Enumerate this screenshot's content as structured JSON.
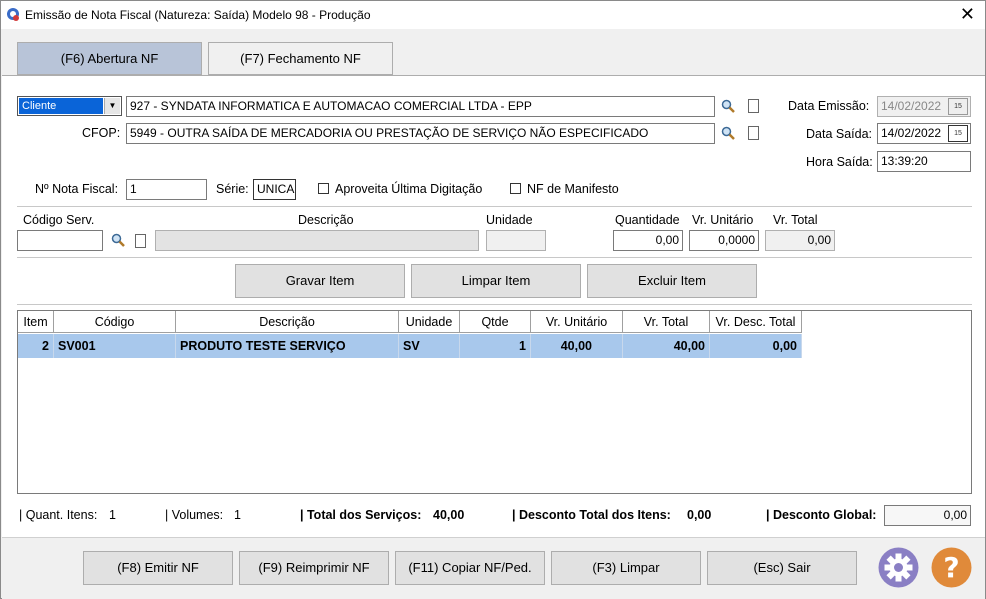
{
  "window": {
    "title": "Emissão de Nota Fiscal (Natureza: Saída) Modelo 98 - Produção",
    "close_glyph": "✕"
  },
  "tabs": [
    {
      "label": "(F6) Abertura NF"
    },
    {
      "label": "(F7) Fechamento NF"
    }
  ],
  "header": {
    "party_type": "Cliente",
    "party_value": "927 - SYNDATA INFORMATICA E AUTOMACAO COMERCIAL LTDA - EPP",
    "cfop_label": "CFOP:",
    "cfop_value": "5949 - OUTRA SAÍDA DE MERCADORIA OU PRESTAÇÃO DE SERVIÇO NÃO ESPECIFICADO",
    "data_emissao_label": "Data Emissão:",
    "data_emissao_value": "14/02/2022",
    "data_saida_label": "Data Saída:",
    "data_saida_value": "14/02/2022",
    "hora_saida_label": "Hora Saída:",
    "hora_saida_value": "13:39:20",
    "calendar_day": "15",
    "nf_label": "Nº Nota Fiscal:",
    "nf_value": "1",
    "serie_label": "Série:",
    "serie_value": "UNICA",
    "aproveita_label": "Aproveita Última Digitação",
    "manifesto_label": "NF de Manifesto"
  },
  "item_entry": {
    "codigo_label": "Código Serv.",
    "descricao_label": "Descrição",
    "unidade_label": "Unidade",
    "quantidade_label": "Quantidade",
    "vr_unitario_label": "Vr. Unitário",
    "vr_total_label": "Vr. Total",
    "quantidade_value": "0,00",
    "vr_unitario_value": "0,0000",
    "vr_total_value": "0,00"
  },
  "item_buttons": {
    "gravar": "Gravar Item",
    "limpar": "Limpar Item",
    "excluir": "Excluir Item"
  },
  "table": {
    "columns": [
      "Item",
      "Código",
      "Descrição",
      "Unidade",
      "Qtde",
      "Vr. Unitário",
      "Vr. Total",
      "Vr. Desc. Total"
    ],
    "rows": [
      [
        "2",
        "SV001",
        "PRODUTO TESTE SERVIÇO",
        "SV",
        "1",
        "40,00",
        "40,00",
        "0,00"
      ]
    ]
  },
  "status": {
    "quant_itens_label": "| Quant. Itens:",
    "quant_itens_value": "1",
    "volumes_label": "| Volumes:",
    "volumes_value": "1",
    "total_servicos_label": "| Total dos Serviços:",
    "total_servicos_value": "40,00",
    "desconto_itens_label": "| Desconto Total dos Itens:",
    "desconto_itens_value": "0,00",
    "desconto_global_label": "| Desconto Global:",
    "desconto_global_value": "0,00"
  },
  "footer_buttons": {
    "emitir": "(F8) Emitir NF",
    "reimprimir": "(F9) Reimprimir NF",
    "copiar": "(F11) Copiar NF/Ped.",
    "limpar": "(F3) Limpar",
    "sair": "(Esc) Sair"
  },
  "colors": {
    "tab_active": "#b8c4d8",
    "row_selected": "#a8c8ec",
    "gear": "#8a7fc4",
    "help": "#e08a3a"
  }
}
